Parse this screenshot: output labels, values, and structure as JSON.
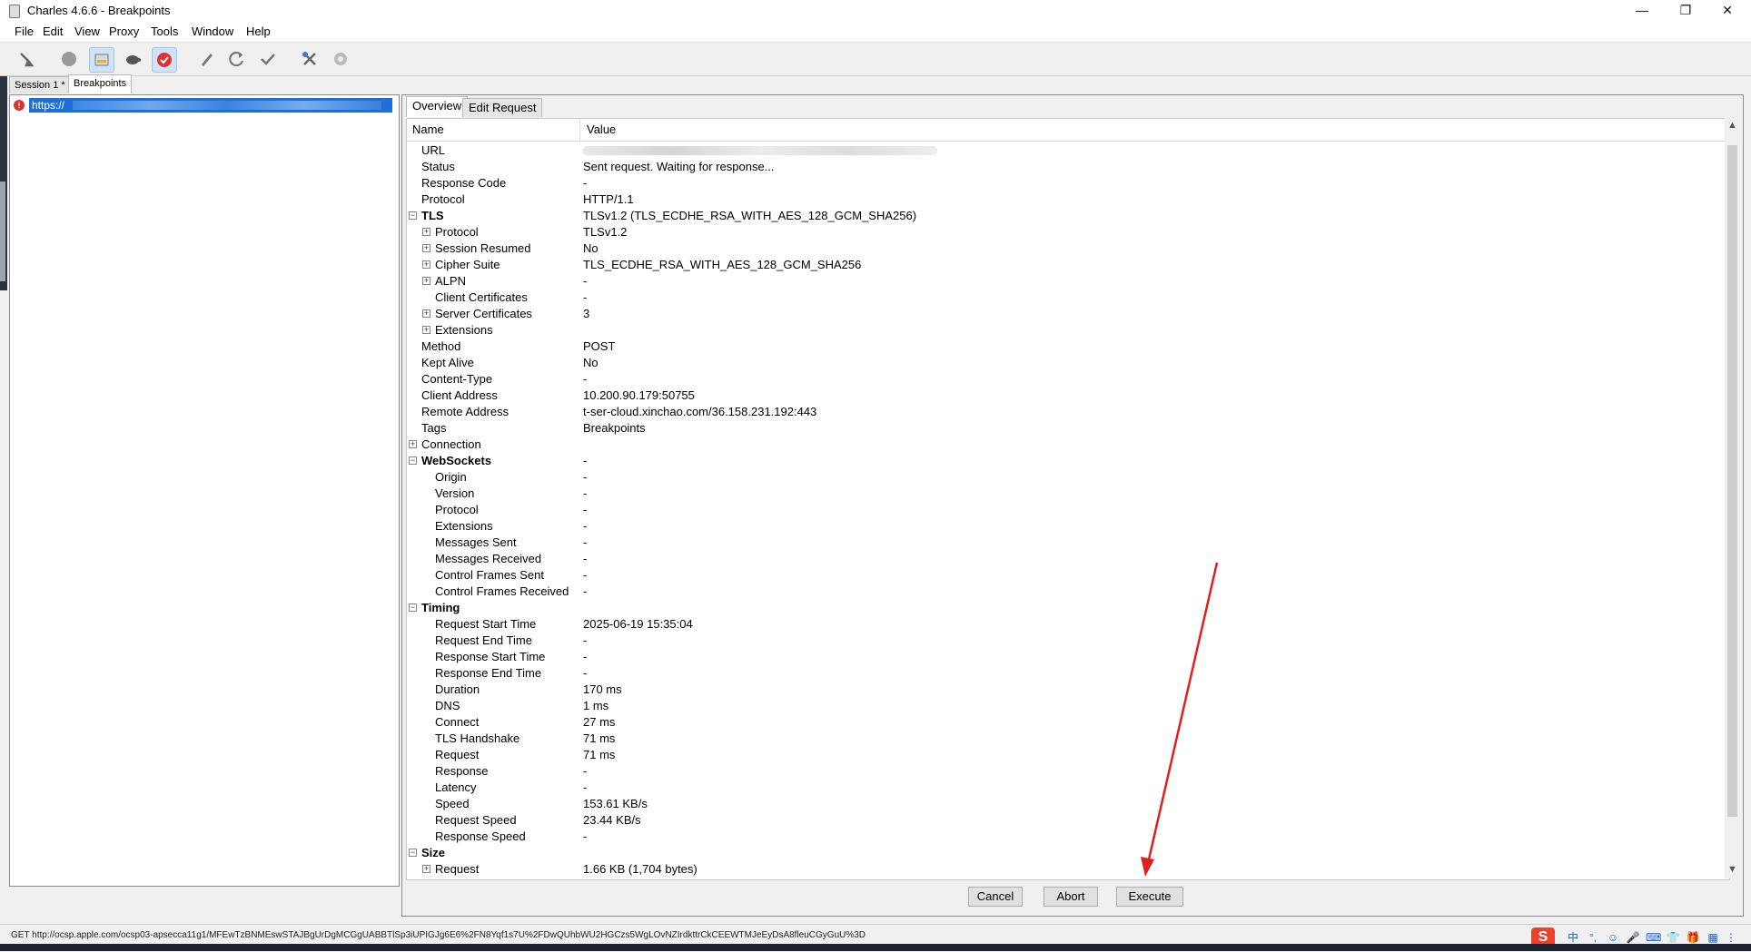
{
  "window": {
    "title": "Charles 4.6.6 - Breakpoints",
    "minimize": "—",
    "restore": "❐",
    "close": "✕"
  },
  "menu": [
    "File",
    "Edit",
    "View",
    "Proxy",
    "Tools",
    "Window",
    "Help"
  ],
  "toolbar": {
    "icons": [
      "broom-icon",
      "record-icon",
      "throttle-icon",
      "turtle-icon",
      "breakpoint-icon",
      "pen-icon",
      "refresh-icon",
      "check-icon",
      "tools-icon",
      "settings-icon"
    ]
  },
  "session_tabs": [
    "Session 1 *",
    "Breakpoints"
  ],
  "left_panel": {
    "items": [
      {
        "label": "https://"
      }
    ]
  },
  "right_tabs": [
    "Overview",
    "Edit Request"
  ],
  "table": {
    "col_name": "Name",
    "col_value": "Value",
    "rows": [
      {
        "name": "URL",
        "value": "",
        "level": 0,
        "expander": "",
        "bold": false
      },
      {
        "name": "Status",
        "value": "Sent request. Waiting for response...",
        "level": 0,
        "expander": "",
        "bold": false
      },
      {
        "name": "Response Code",
        "value": "-",
        "level": 0,
        "expander": "",
        "bold": false
      },
      {
        "name": "Protocol",
        "value": "HTTP/1.1",
        "level": 0,
        "expander": "",
        "bold": false
      },
      {
        "name": "TLS",
        "value": "TLSv1.2 (TLS_ECDHE_RSA_WITH_AES_128_GCM_SHA256)",
        "level": 0,
        "expander": "−",
        "bold": true
      },
      {
        "name": "Protocol",
        "value": "TLSv1.2",
        "level": 1,
        "expander": "+",
        "bold": false
      },
      {
        "name": "Session Resumed",
        "value": "No",
        "level": 1,
        "expander": "+",
        "bold": false
      },
      {
        "name": "Cipher Suite",
        "value": "TLS_ECDHE_RSA_WITH_AES_128_GCM_SHA256",
        "level": 1,
        "expander": "+",
        "bold": false
      },
      {
        "name": "ALPN",
        "value": "-",
        "level": 1,
        "expander": "+",
        "bold": false
      },
      {
        "name": "Client Certificates",
        "value": "-",
        "level": 1,
        "expander": "",
        "bold": false
      },
      {
        "name": "Server Certificates",
        "value": "3",
        "level": 1,
        "expander": "+",
        "bold": false
      },
      {
        "name": "Extensions",
        "value": "",
        "level": 1,
        "expander": "+",
        "bold": false
      },
      {
        "name": "Method",
        "value": "POST",
        "level": 0,
        "expander": "",
        "bold": false
      },
      {
        "name": "Kept Alive",
        "value": "No",
        "level": 0,
        "expander": "",
        "bold": false
      },
      {
        "name": "Content-Type",
        "value": "-",
        "level": 0,
        "expander": "",
        "bold": false
      },
      {
        "name": "Client Address",
        "value": "10.200.90.179:50755",
        "level": 0,
        "expander": "",
        "bold": false
      },
      {
        "name": "Remote Address",
        "value": "t-ser-cloud.xinchao.com/36.158.231.192:443",
        "level": 0,
        "expander": "",
        "bold": false
      },
      {
        "name": "Tags",
        "value": "Breakpoints",
        "level": 0,
        "expander": "",
        "bold": false
      },
      {
        "name": "Connection",
        "value": "",
        "level": 0,
        "expander": "+",
        "bold": false
      },
      {
        "name": "WebSockets",
        "value": "-",
        "level": 0,
        "expander": "−",
        "bold": true
      },
      {
        "name": "Origin",
        "value": "-",
        "level": 1,
        "expander": "",
        "bold": false
      },
      {
        "name": "Version",
        "value": "-",
        "level": 1,
        "expander": "",
        "bold": false
      },
      {
        "name": "Protocol",
        "value": "-",
        "level": 1,
        "expander": "",
        "bold": false
      },
      {
        "name": "Extensions",
        "value": "-",
        "level": 1,
        "expander": "",
        "bold": false
      },
      {
        "name": "Messages Sent",
        "value": "-",
        "level": 1,
        "expander": "",
        "bold": false
      },
      {
        "name": "Messages Received",
        "value": "-",
        "level": 1,
        "expander": "",
        "bold": false
      },
      {
        "name": "Control Frames Sent",
        "value": "-",
        "level": 1,
        "expander": "",
        "bold": false
      },
      {
        "name": "Control Frames Received",
        "value": "-",
        "level": 1,
        "expander": "",
        "bold": false
      },
      {
        "name": "Timing",
        "value": "",
        "level": 0,
        "expander": "−",
        "bold": true
      },
      {
        "name": "Request Start Time",
        "value": "2025-06-19 15:35:04",
        "level": 1,
        "expander": "",
        "bold": false
      },
      {
        "name": "Request End Time",
        "value": "-",
        "level": 1,
        "expander": "",
        "bold": false
      },
      {
        "name": "Response Start Time",
        "value": "-",
        "level": 1,
        "expander": "",
        "bold": false
      },
      {
        "name": "Response End Time",
        "value": "-",
        "level": 1,
        "expander": "",
        "bold": false
      },
      {
        "name": "Duration",
        "value": "170 ms",
        "level": 1,
        "expander": "",
        "bold": false
      },
      {
        "name": "DNS",
        "value": "1 ms",
        "level": 1,
        "expander": "",
        "bold": false
      },
      {
        "name": "Connect",
        "value": "27 ms",
        "level": 1,
        "expander": "",
        "bold": false
      },
      {
        "name": "TLS Handshake",
        "value": "71 ms",
        "level": 1,
        "expander": "",
        "bold": false
      },
      {
        "name": "Request",
        "value": "71 ms",
        "level": 1,
        "expander": "",
        "bold": false
      },
      {
        "name": "Response",
        "value": "-",
        "level": 1,
        "expander": "",
        "bold": false
      },
      {
        "name": "Latency",
        "value": "-",
        "level": 1,
        "expander": "",
        "bold": false
      },
      {
        "name": "Speed",
        "value": "153.61 KB/s",
        "level": 1,
        "expander": "",
        "bold": false
      },
      {
        "name": "Request Speed",
        "value": "23.44 KB/s",
        "level": 1,
        "expander": "",
        "bold": false
      },
      {
        "name": "Response Speed",
        "value": "-",
        "level": 1,
        "expander": "",
        "bold": false
      },
      {
        "name": "Size",
        "value": "",
        "level": 0,
        "expander": "−",
        "bold": true
      },
      {
        "name": "Request",
        "value": "1.66 KB (1,704 bytes)",
        "level": 1,
        "expander": "+",
        "bold": false
      }
    ]
  },
  "buttons": {
    "cancel": "Cancel",
    "abort": "Abort",
    "execute": "Execute"
  },
  "status_bar": {
    "text": "GET http://ocsp.apple.com/ocsp03-apsecca11g1/MFEwTzBNMEswSTAJBgUrDgMCGgUABBTlSp3iUPIGJg6E6%2FN8Yqf1s7U%2FDwQUhbWU2HGCzs5WgLOvNZIrdkttrCkCEEWTMJeEyDsA8fleuCGyGuU%3D",
    "tray": [
      "S",
      "中",
      "°,",
      "☺",
      "🎤",
      "⌨",
      "👕",
      "🎁",
      "▦",
      "⋮"
    ]
  }
}
